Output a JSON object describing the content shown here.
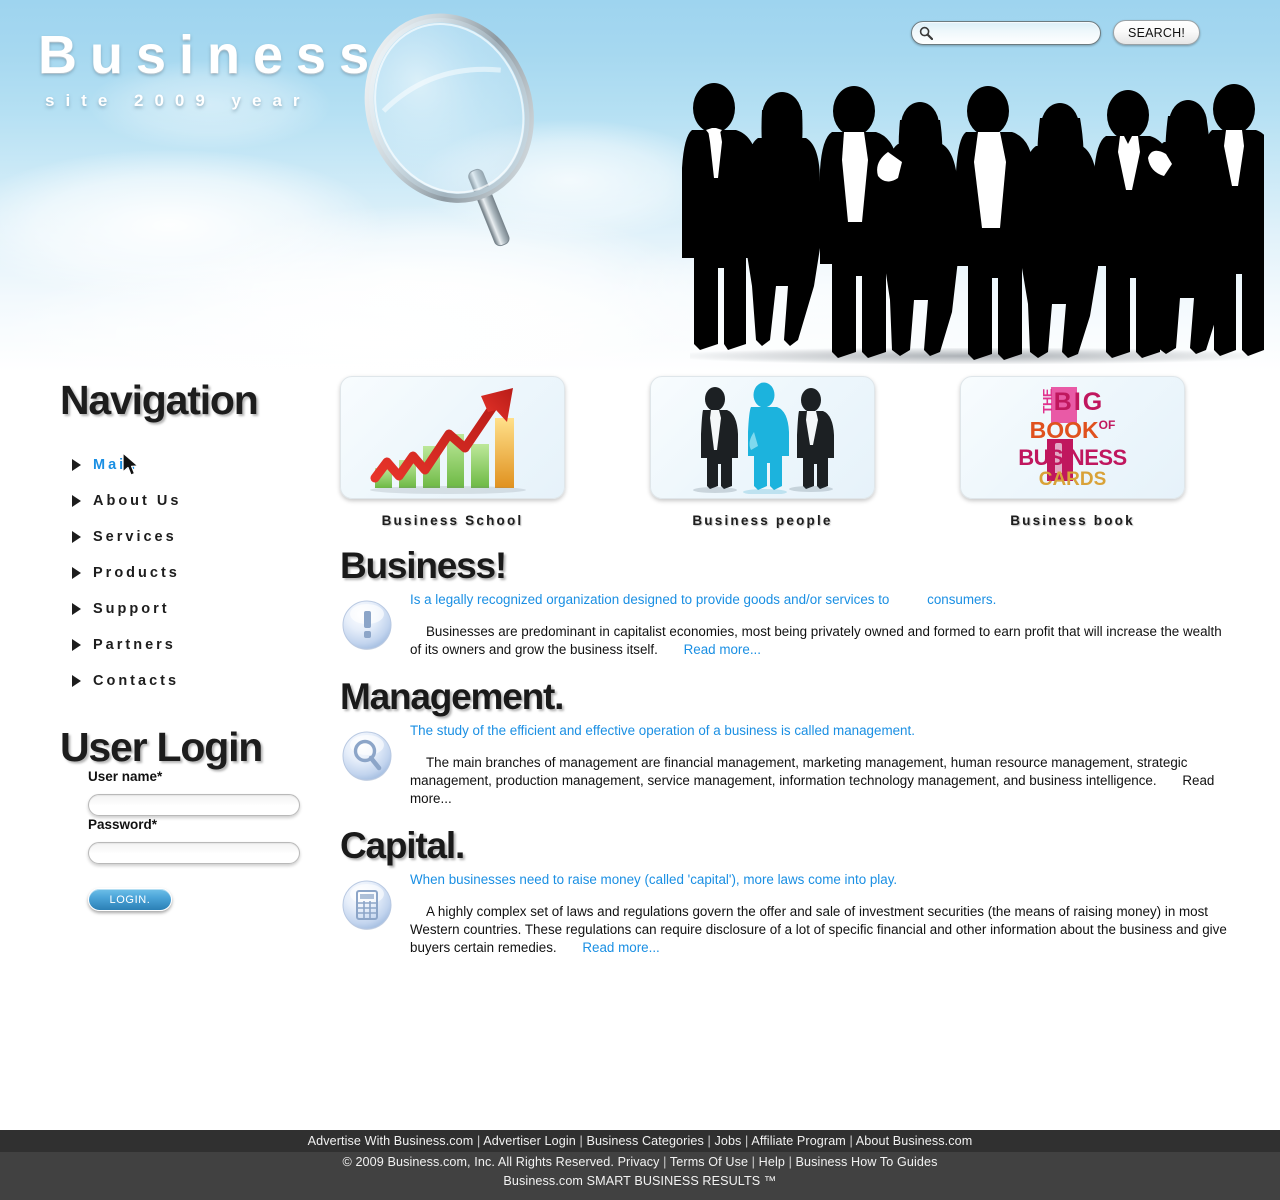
{
  "header": {
    "logo_main": "Business",
    "logo_sub": "site 2009 year",
    "magnifier_icon": "magnifier-icon",
    "people_image_alt": "business-people-silhouettes"
  },
  "search": {
    "icon": "search-icon",
    "value": "",
    "placeholder": "",
    "button_label": "SEARCH!"
  },
  "sidebar": {
    "nav_title": "Navigation",
    "nav_items": [
      {
        "label": "Main",
        "active": true
      },
      {
        "label": "About Us",
        "active": false
      },
      {
        "label": "Services",
        "active": false
      },
      {
        "label": "Products",
        "active": false
      },
      {
        "label": "Support",
        "active": false
      },
      {
        "label": "Partners",
        "active": false
      },
      {
        "label": "Contacts",
        "active": false
      }
    ],
    "login_title": "User Login",
    "username_label": "User name*",
    "username_value": "",
    "password_label": "Password*",
    "password_value": "",
    "login_button": "LOGIN."
  },
  "cards": [
    {
      "caption": "Business School",
      "image": "growth-chart-image"
    },
    {
      "caption": "Business people",
      "image": "businessmen-silhouettes-image"
    },
    {
      "caption": "Business book",
      "image": "big-book-of-business-cards-image"
    }
  ],
  "book_cover": {
    "line1_the": "THE",
    "line1_big": "BIG",
    "line2_book": "BOOK",
    "line2_of": "OF",
    "line3": "BUSINESS",
    "line4": "CARDS"
  },
  "articles": [
    {
      "title": "Business!",
      "icon": "exclamation-icon",
      "lead": "Is a legally recognized organization designed to provide goods and/or services to",
      "lead_tail": "consumers.",
      "body": "Businesses are predominant in capitalist economies, most being privately owned and formed to earn profit that will increase the wealth of its owners and grow the business itself.",
      "read_more": "Read more...",
      "read_more_color": "#1a8fe3"
    },
    {
      "title": "Management.",
      "icon": "magnifier-icon",
      "lead": "The study of the efficient and effective operation of a business is called management.",
      "lead_tail": "",
      "body": "The main branches of management are financial management, marketing management, human resource management, strategic management, production management, service management, information technology management, and business intelligence.",
      "read_more": "Read more...",
      "read_more_color": "#111111"
    },
    {
      "title": "Capital.",
      "icon": "calculator-icon",
      "lead": "When businesses need to raise money (called 'capital'), more laws come into play.",
      "lead_tail": "",
      "body": "A highly complex set of laws and regulations govern the offer and sale of investment securities (the means of raising money) in most Western countries. These regulations can require disclosure of a lot of specific financial and other information about the business and give buyers certain remedies.",
      "read_more": "Read more...",
      "read_more_color": "#1a8fe3"
    }
  ],
  "footer": {
    "line1": [
      "Advertise With Business.com",
      "Advertiser Login",
      "Business Categories",
      "Jobs",
      "Affiliate Program",
      "About Business.com"
    ],
    "line2_prefix": "© 2009 Business.com, Inc. All Rights Reserved.",
    "line2_links": [
      "Privacy",
      "Terms Of Use",
      "Help",
      "Business How To Guides"
    ],
    "line3": "Business.com SMART BUSINESS RESULTS ™"
  },
  "colors": {
    "accent_blue": "#1a8fe3",
    "sky_top": "#9ed4ef",
    "footer_top": "#303030",
    "footer_bottom": "#414141",
    "login_button": "#2b7fb5"
  }
}
